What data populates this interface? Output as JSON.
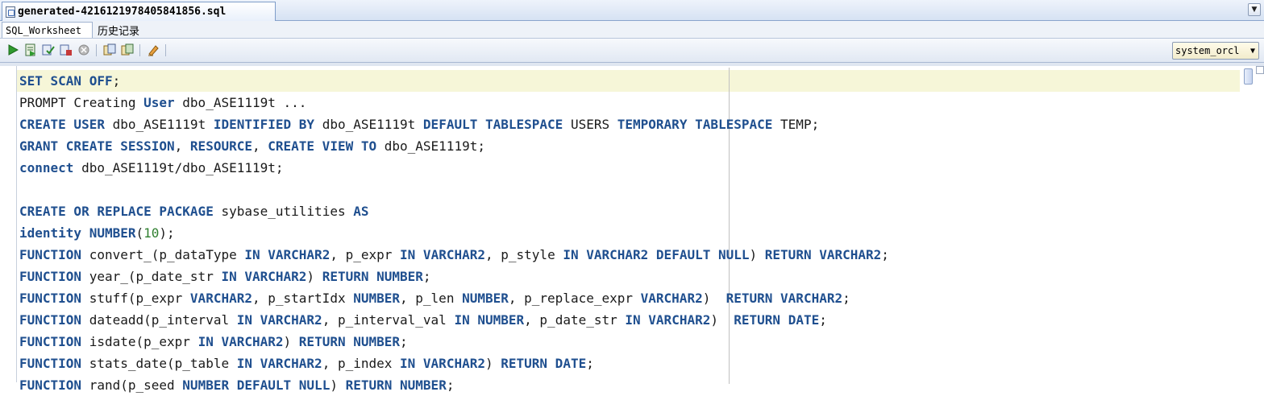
{
  "file_tab": {
    "title": "generated-4216121978405841856.sql"
  },
  "sub_tabs": [
    {
      "label": "SQL_Worksheet"
    },
    {
      "label": "历史记录"
    }
  ],
  "toolbar": {
    "icons": [
      "run-statement-icon",
      "run-script-icon",
      "commit-icon",
      "rollback-icon",
      "cancel-icon",
      "autotrace-icon",
      "explain-plan-icon",
      "clear-icon"
    ],
    "connection": "system_orcl"
  },
  "editor": {
    "lines": [
      [
        {
          "t": "SET SCAN OFF",
          "k": 1
        },
        {
          "t": ";"
        }
      ],
      [
        {
          "t": "PROMPT Creating "
        },
        {
          "t": "User",
          "k": 1
        },
        {
          "t": " dbo_ASE1119t ..."
        }
      ],
      [
        {
          "t": "CREATE USER",
          "k": 1
        },
        {
          "t": " dbo_ASE1119t "
        },
        {
          "t": "IDENTIFIED BY",
          "k": 1
        },
        {
          "t": " dbo_ASE1119t "
        },
        {
          "t": "DEFAULT TABLESPACE",
          "k": 1
        },
        {
          "t": " USERS "
        },
        {
          "t": "TEMPORARY TABLESPACE",
          "k": 1
        },
        {
          "t": " TEMP;"
        }
      ],
      [
        {
          "t": "GRANT CREATE SESSION",
          "k": 1
        },
        {
          "t": ", "
        },
        {
          "t": "RESOURCE",
          "k": 1
        },
        {
          "t": ", "
        },
        {
          "t": "CREATE VIEW TO",
          "k": 1
        },
        {
          "t": " dbo_ASE1119t;"
        }
      ],
      [
        {
          "t": "connect",
          "k": 1
        },
        {
          "t": " dbo_ASE1119t/dbo_ASE1119t;"
        }
      ],
      [],
      [
        {
          "t": "CREATE OR REPLACE PACKAGE",
          "k": 1
        },
        {
          "t": " sybase_utilities "
        },
        {
          "t": "AS",
          "k": 1
        }
      ],
      [
        {
          "t": "identity NUMBER",
          "k": 1
        },
        {
          "t": "("
        },
        {
          "t": "10",
          "n": 1
        },
        {
          "t": ");"
        }
      ],
      [
        {
          "t": "FUNCTION",
          "k": 1
        },
        {
          "t": " convert_(p_dataType "
        },
        {
          "t": "IN VARCHAR2",
          "k": 1
        },
        {
          "t": ", p_expr "
        },
        {
          "t": "IN VARCHAR2",
          "k": 1
        },
        {
          "t": ", p_style "
        },
        {
          "t": "IN VARCHAR2 DEFAULT NULL",
          "k": 1
        },
        {
          "t": ") "
        },
        {
          "t": "RETURN VARCHAR2",
          "k": 1
        },
        {
          "t": ";"
        }
      ],
      [
        {
          "t": "FUNCTION",
          "k": 1
        },
        {
          "t": " year_(p_date_str "
        },
        {
          "t": "IN VARCHAR2",
          "k": 1
        },
        {
          "t": ") "
        },
        {
          "t": "RETURN NUMBER",
          "k": 1
        },
        {
          "t": ";"
        }
      ],
      [
        {
          "t": "FUNCTION",
          "k": 1
        },
        {
          "t": " stuff(p_expr "
        },
        {
          "t": "VARCHAR2",
          "k": 1
        },
        {
          "t": ", p_startIdx "
        },
        {
          "t": "NUMBER",
          "k": 1
        },
        {
          "t": ", p_len "
        },
        {
          "t": "NUMBER",
          "k": 1
        },
        {
          "t": ", p_replace_expr "
        },
        {
          "t": "VARCHAR2",
          "k": 1
        },
        {
          "t": ")  "
        },
        {
          "t": "RETURN VARCHAR2",
          "k": 1
        },
        {
          "t": ";"
        }
      ],
      [
        {
          "t": "FUNCTION",
          "k": 1
        },
        {
          "t": " dateadd(p_interval "
        },
        {
          "t": "IN VARCHAR2",
          "k": 1
        },
        {
          "t": ", p_interval_val "
        },
        {
          "t": "IN NUMBER",
          "k": 1
        },
        {
          "t": ", p_date_str "
        },
        {
          "t": "IN VARCHAR2",
          "k": 1
        },
        {
          "t": ")  "
        },
        {
          "t": "RETURN DATE",
          "k": 1
        },
        {
          "t": ";"
        }
      ],
      [
        {
          "t": "FUNCTION",
          "k": 1
        },
        {
          "t": " isdate(p_expr "
        },
        {
          "t": "IN VARCHAR2",
          "k": 1
        },
        {
          "t": ") "
        },
        {
          "t": "RETURN NUMBER",
          "k": 1
        },
        {
          "t": ";"
        }
      ],
      [
        {
          "t": "FUNCTION",
          "k": 1
        },
        {
          "t": " stats_date(p_table "
        },
        {
          "t": "IN VARCHAR2",
          "k": 1
        },
        {
          "t": ", p_index "
        },
        {
          "t": "IN VARCHAR2",
          "k": 1
        },
        {
          "t": ") "
        },
        {
          "t": "RETURN DATE",
          "k": 1
        },
        {
          "t": ";"
        }
      ],
      [
        {
          "t": "FUNCTION",
          "k": 1
        },
        {
          "t": " rand(p_seed "
        },
        {
          "t": "NUMBER DEFAULT NULL",
          "k": 1
        },
        {
          "t": ") "
        },
        {
          "t": "RETURN NUMBER",
          "k": 1
        },
        {
          "t": ";"
        }
      ]
    ]
  }
}
